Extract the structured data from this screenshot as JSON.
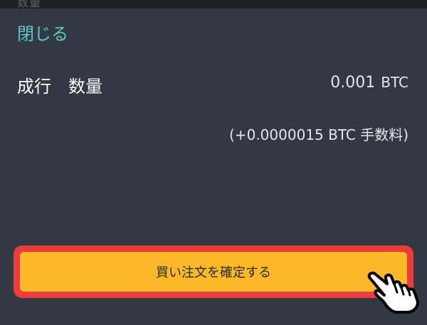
{
  "header": {
    "top_label": "数量"
  },
  "sheet": {
    "close_label": "閉じる",
    "order_type": "成行",
    "quantity_label": "数量",
    "quantity_value": "0.001",
    "quantity_unit": "BTC",
    "fee_text": "(+0.0000015 BTC 手数料)",
    "confirm_button_label": "買い注文を確定する"
  },
  "colors": {
    "background": "#1f252b",
    "sheet": "#313942",
    "close_link": "#63c6c6",
    "confirm_button": "#fbb829",
    "highlight_border": "#ee3b3b"
  },
  "icons": {
    "cursor": "pointing-hand-icon"
  }
}
